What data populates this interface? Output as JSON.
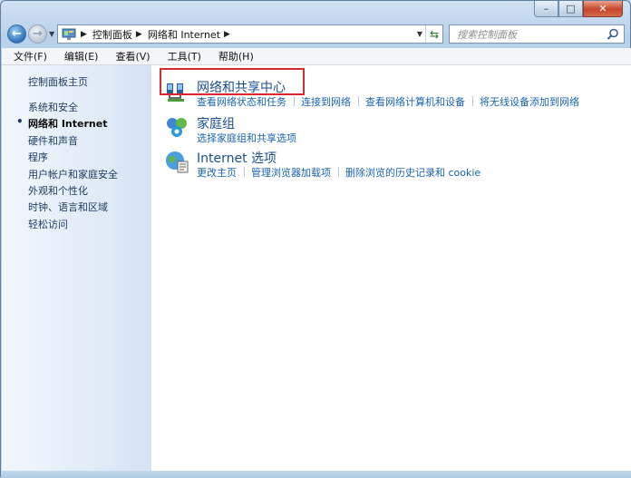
{
  "window": {
    "caption": {
      "minimize": "–",
      "maximize": "□",
      "close": "✕"
    }
  },
  "nav": {
    "back_icon": "back-arrow-icon",
    "forward_icon": "forward-arrow-icon",
    "recent_icon": "dropdown-icon",
    "address_icon": "control-panel-icon",
    "breadcrumbs": [
      "控制面板",
      "网络和 Internet"
    ],
    "separator": "▶",
    "dropdown_glyph": "▼",
    "refresh_glyph": "⇆",
    "search_placeholder": "搜索控制面板"
  },
  "menubar": [
    "文件(F)",
    "编辑(E)",
    "查看(V)",
    "工具(T)",
    "帮助(H)"
  ],
  "sidebar": {
    "home": "控制面板主页",
    "items": [
      {
        "label": "系统和安全",
        "active": false
      },
      {
        "label": "网络和 Internet",
        "active": true
      },
      {
        "label": "硬件和声音",
        "active": false
      },
      {
        "label": "程序",
        "active": false
      },
      {
        "label": "用户帐户和家庭安全",
        "active": false
      },
      {
        "label": "外观和个性化",
        "active": false
      },
      {
        "label": "时钟、语言和区域",
        "active": false
      },
      {
        "label": "轻松访问",
        "active": false
      }
    ]
  },
  "categories": [
    {
      "title": "网络和共享中心",
      "icon": "network-sharing-center-icon",
      "links": [
        "查看网络状态和任务",
        "连接到网络",
        "查看网络计算机和设备",
        "将无线设备添加到网络"
      ]
    },
    {
      "title": "家庭组",
      "icon": "homegroup-icon",
      "links": [
        "选择家庭组和共享选项"
      ]
    },
    {
      "title": "Internet 选项",
      "icon": "internet-options-icon",
      "links": [
        "更改主页",
        "管理浏览器加载项",
        "删除浏览的历史记录和 cookie"
      ]
    }
  ],
  "colors": {
    "link": "#1a63b0",
    "title": "#1b4e8f",
    "highlight_box": "#d9262f"
  }
}
